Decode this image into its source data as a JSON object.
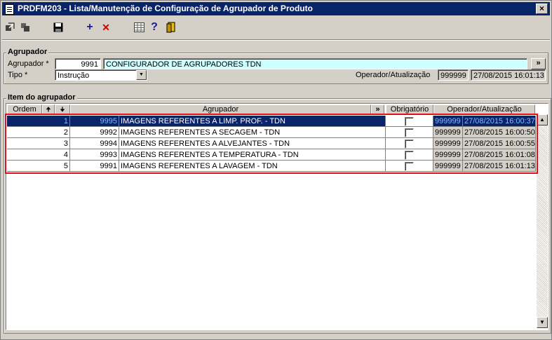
{
  "window": {
    "title": "PRDFM203 - Lista/Manutenção de Configuração de Agrupador de Produto",
    "close_label": "×"
  },
  "toolbar": {
    "add_symbol": "+",
    "delete_symbol": "✕",
    "help_symbol": "?"
  },
  "header_group": {
    "title": "Agrupador",
    "agrupador_label": "Agrupador *",
    "agrupador_code": "9991",
    "agrupador_desc": "CONFIGURADOR DE AGRUPADORES TDN",
    "more_button": "»",
    "tipo_label": "Tipo *",
    "tipo_value": "Instrução",
    "operador_label": "Operador/Atualização",
    "operador_value": "999999",
    "atualizacao_value": "27/08/2015 16:01:13"
  },
  "items_group": {
    "title": "Item do agrupador",
    "columns": {
      "ordem": "Ordem",
      "up": "🠉",
      "down": "🠋",
      "agrupador": "Agrupador",
      "more": "»",
      "obrigatorio": "Obrigatório",
      "operador": "Operador/Atualização"
    },
    "rows": [
      {
        "ordem": "1",
        "codigo": "9995",
        "descricao": "IMAGENS REFERENTES A LIMP. PROF. - TDN",
        "obrigatorio": false,
        "operador": "999999",
        "data": "27/08/2015 16:00:37"
      },
      {
        "ordem": "2",
        "codigo": "9992",
        "descricao": "IMAGENS REFERENTES A SECAGEM - TDN",
        "obrigatorio": false,
        "operador": "999999",
        "data": "27/08/2015 16:00:50"
      },
      {
        "ordem": "3",
        "codigo": "9994",
        "descricao": "IMAGENS REFERENTES A ALVEJANTES - TDN",
        "obrigatorio": false,
        "operador": "999999",
        "data": "27/08/2015 16:00:55"
      },
      {
        "ordem": "4",
        "codigo": "9993",
        "descricao": "IMAGENS REFERENTES A TEMPERATURA - TDN",
        "obrigatorio": false,
        "operador": "999999",
        "data": "27/08/2015 16:01:08"
      },
      {
        "ordem": "5",
        "codigo": "9991",
        "descricao": "IMAGENS REFERENTES A LAVAGEM - TDN",
        "obrigatorio": false,
        "operador": "999999",
        "data": "27/08/2015 16:01:13"
      }
    ]
  },
  "colors": {
    "selection": "#0a246a",
    "highlight_border": "#e0101c",
    "cyan_field": "#ccffff"
  }
}
